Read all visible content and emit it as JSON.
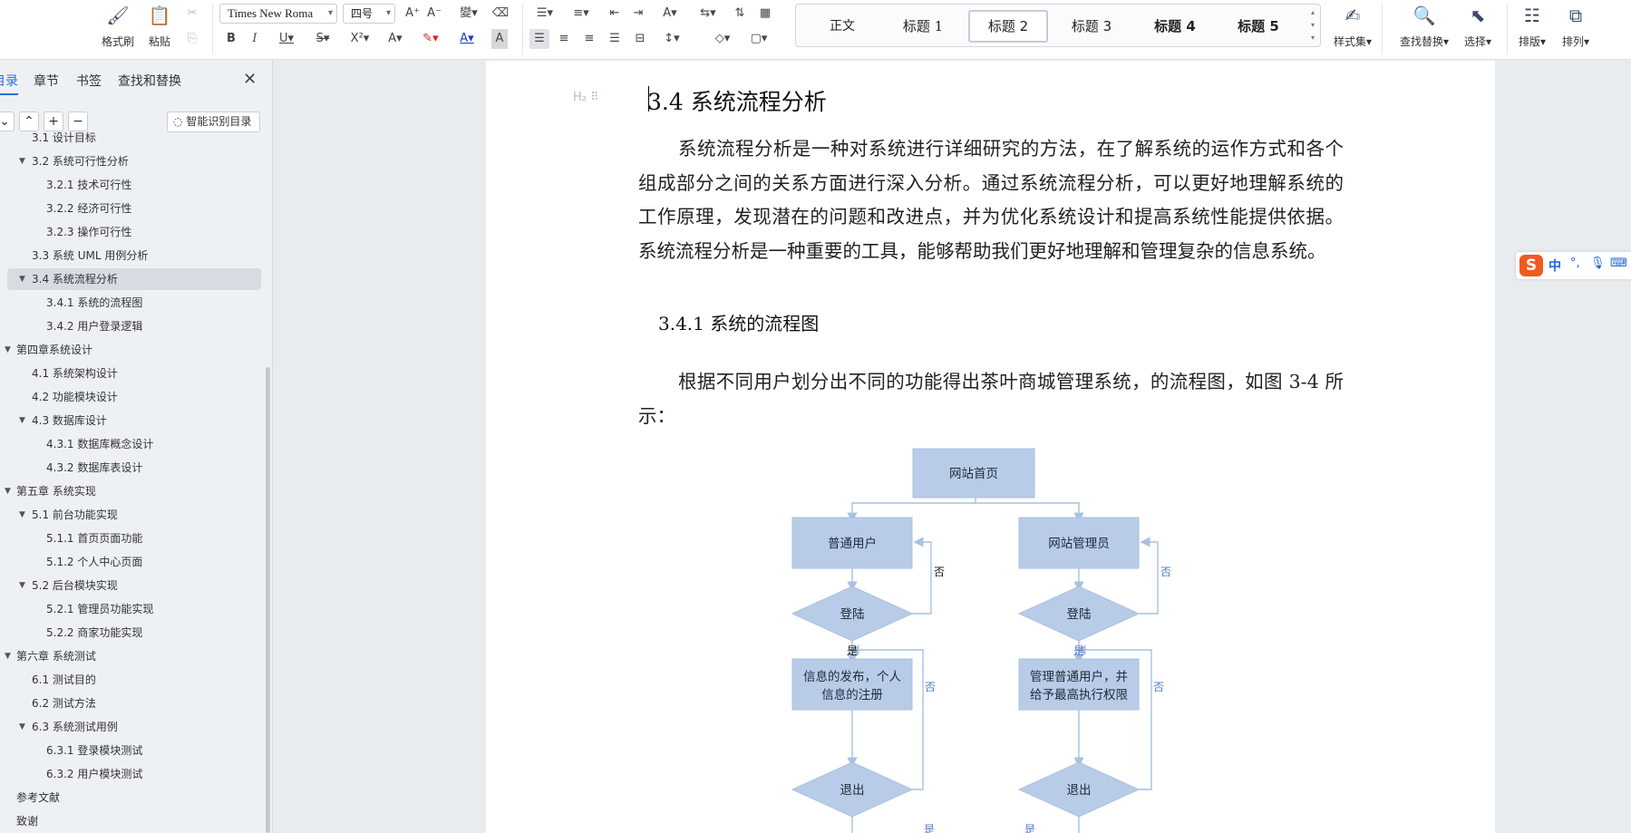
{
  "ribbon": {
    "format_painter": "格式刷",
    "paste": "粘贴",
    "font_name": "Times New Roma",
    "font_size": "四号",
    "styles": [
      "正文",
      "标题  1",
      "标题  2",
      "标题  3",
      "标题  4",
      "标题  5"
    ],
    "style_set": "样式集",
    "find_replace": "查找替换",
    "select": "选择",
    "layout": "排版",
    "arrange": "排列"
  },
  "leftpane": {
    "tabs": [
      "目录",
      "章节",
      "书签",
      "查找和替换"
    ],
    "smart_toc": "智能识别目录",
    "toc": [
      {
        "label": "3.1 设计目标",
        "level": 2
      },
      {
        "label": "3.2 系统可行性分析",
        "level": 2,
        "expanded": true
      },
      {
        "label": "3.2.1 技术可行性",
        "level": 3
      },
      {
        "label": "3.2.2 经济可行性",
        "level": 3
      },
      {
        "label": "3.2.3 操作可行性",
        "level": 3
      },
      {
        "label": "3.3 系统 UML 用例分析",
        "level": 2
      },
      {
        "label": "3.4 系统流程分析",
        "level": 2,
        "expanded": true,
        "active": true
      },
      {
        "label": "3.4.1 系统的流程图",
        "level": 3
      },
      {
        "label": "3.4.2 用户登录逻辑",
        "level": 3
      },
      {
        "label": "第四章系统设计",
        "level": 1,
        "expanded": true
      },
      {
        "label": "4.1  系统架构设计",
        "level": 2
      },
      {
        "label": "4.2 功能模块设计",
        "level": 2
      },
      {
        "label": "4.3  数据库设计",
        "level": 2,
        "expanded": true
      },
      {
        "label": "4.3.1 数据库概念设计",
        "level": 3
      },
      {
        "label": "4.3.2  数据库表设计",
        "level": 3
      },
      {
        "label": "第五章  系统实现",
        "level": 1,
        "expanded": true
      },
      {
        "label": "5.1 前台功能实现",
        "level": 2,
        "expanded": true
      },
      {
        "label": "5.1.1 首页页面功能",
        "level": 3
      },
      {
        "label": "5.1.2 个人中心页面",
        "level": 3
      },
      {
        "label": "5.2 后台模块实现",
        "level": 2,
        "expanded": true
      },
      {
        "label": "5.2.1 管理员功能实现",
        "level": 3
      },
      {
        "label": "5.2.2 商家功能实现",
        "level": 3
      },
      {
        "label": "第六章  系统测试",
        "level": 1,
        "expanded": true
      },
      {
        "label": "6.1 测试目的",
        "level": 2
      },
      {
        "label": "6.2 测试方法",
        "level": 2
      },
      {
        "label": "6.3 系统测试用例",
        "level": 2,
        "expanded": true
      },
      {
        "label": "6.3.1 登录模块测试",
        "level": 3
      },
      {
        "label": "6.3.2 用户模块测试",
        "level": 3
      },
      {
        "label": "参考文献",
        "level": 1
      },
      {
        "label": "致谢",
        "level": 1
      }
    ]
  },
  "document": {
    "heading_marker": "H₂",
    "h2": "3.4 系统流程分析",
    "para1": "系统流程分析是一种对系统进行详细研究的方法，在了解系统的运作方式和各个组成部分之间的关系方面进行深入分析。通过系统流程分析，可以更好地理解系统的工作原理，发现潜在的问题和改进点，并为优化系统设计和提高系统性能提供依据。系统流程分析是一种重要的工具，能够帮助我们更好地理解和管理复杂的信息系统。",
    "h3": "3.4.1 系统的流程图",
    "para2": "根据不同用户划分出不同的功能得出茶叶商城管理系统，的流程图，如图 3-4 所示：",
    "flowchart": {
      "home": "网站首页",
      "user": "普通用户",
      "admin": "网站管理员",
      "login": "登陆",
      "user_action_1": "信息的发布，个人",
      "user_action_2": "信息的注册",
      "admin_action_1": "管理普通用户，并",
      "admin_action_2": "给予最高执行权限",
      "logout": "退出",
      "no": "否",
      "yes": "是"
    }
  },
  "ime": {
    "zh": "中"
  },
  "colors": {
    "accent": "#2a6de0",
    "box_fill": "#b8cce8",
    "connector": "#a9c0e0"
  }
}
